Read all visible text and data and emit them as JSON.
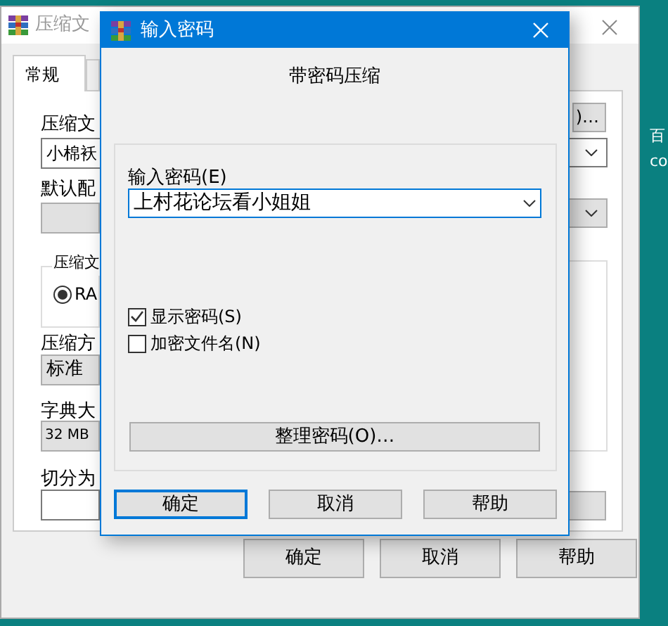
{
  "desktop": {
    "labels": [
      "百",
      "co"
    ]
  },
  "back_window": {
    "title": "压缩文",
    "tabs": [
      {
        "label": "常规",
        "selected": true
      },
      {
        "selected": false
      }
    ],
    "archive_label": "压缩文",
    "archive_name": "小棉袄",
    "profile_label": "默认配",
    "format_label": "压缩文",
    "formats": [
      {
        "label": "RA",
        "selected": true
      }
    ],
    "method_label": "压缩方",
    "method_value": "标准",
    "dict_label": "字典大",
    "dict_value": "32 MB",
    "split_label": "切分为",
    "browse_button": ")…",
    "buttons": [
      "确定",
      "取消",
      "帮助"
    ]
  },
  "dialog": {
    "title": "输入密码",
    "heading": "带密码压缩",
    "password_label": "输入密码(E)",
    "password_value": "上村花论坛看小姐姐",
    "options": [
      {
        "label": "显示密码(S)",
        "checked": true
      },
      {
        "label": "加密文件名(N)",
        "checked": false
      }
    ],
    "organize_button": "整理密码(O)…",
    "buttons": [
      {
        "label": "确定",
        "focused": true
      },
      {
        "label": "取消",
        "focused": false
      },
      {
        "label": "帮助",
        "focused": false
      }
    ]
  }
}
